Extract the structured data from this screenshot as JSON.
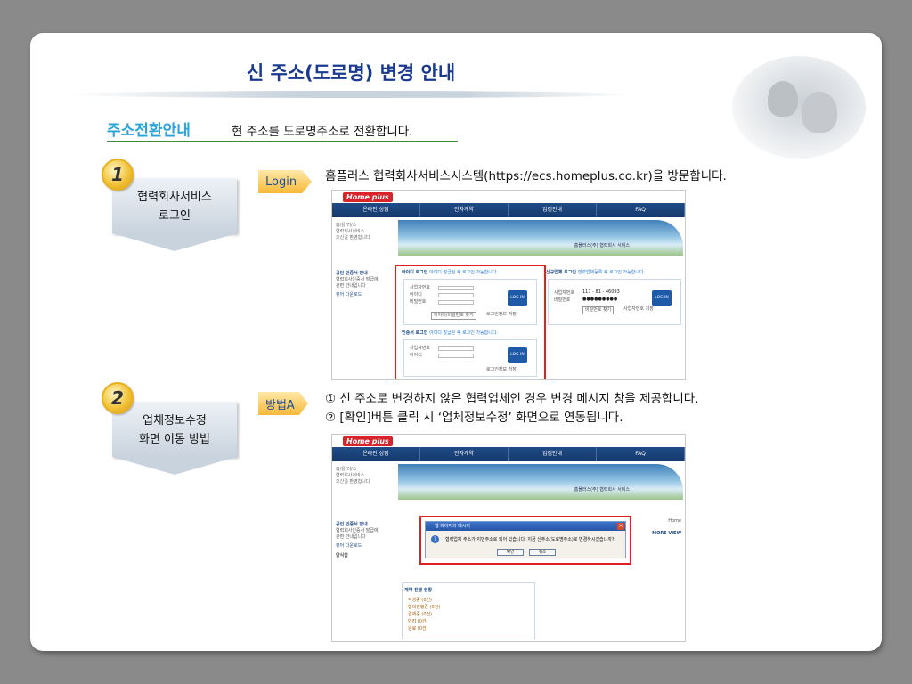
{
  "title": "신 주소(도로명) 변경 안내",
  "section": {
    "title": "주소전환안내",
    "desc": "현 주소를 도로명주소로 전환합니다."
  },
  "steps": [
    {
      "num": "1",
      "label_line1": "협력회사서비스",
      "label_line2": "로그인",
      "tag": "Login",
      "desc": [
        "홈플러스 협력회사서비스시스템(https://ecs.homeplus.co.kr)을 방문합니다."
      ]
    },
    {
      "num": "2",
      "label_line1": "업체정보수정",
      "label_line2": "화면 이동 방법",
      "tag": "방법A",
      "desc": [
        "① 신 주소로 변경하지 않은 협력업체인 경우 변경 메시지 창을 제공합니다.",
        "② [확인]버튼 클릭 시 ‘업체정보수정’ 화면으로 연동됩니다."
      ]
    }
  ],
  "shot1": {
    "logo": "Home plus",
    "nav": [
      "온라인 상담",
      "전자계약",
      "입점안내",
      "FAQ"
    ],
    "side": [
      "홈/플/러/스",
      "협력회사서비스",
      "오신걸 환영합니다"
    ],
    "side2": [
      "공인 인증서 안내",
      "협력회사인증서 발급에",
      "관련 안내입니다",
      "뷰어  다운로드"
    ],
    "banner_text": "홈플러스(주) 협력회사 서비스",
    "id_login": {
      "title": "아이디 로그인",
      "hint": "아이디 발급된 후 로그인 가능합니다.",
      "f1": "사업자번호",
      "f2": "아이디",
      "f3": "비밀번호",
      "btn": "LOG IN",
      "save": "로그인정보 저장",
      "find": "아이디/비밀번호 찾기"
    },
    "cert_login": {
      "title": "인증서 로그인",
      "hint": "아이디 발급된 후 로그인 가능합니다.",
      "f1": "사업자번호",
      "f2": "아이디",
      "btn": "LOG IN",
      "save": "로그인정보 저장"
    },
    "new_login": {
      "title": "신규업체 로그인",
      "hint": "협력업체등록 후 로그인 가능합니다.",
      "f1": "사업자번호",
      "f2": "비밀번호",
      "v1": "117 - 81 - 46093",
      "v2": "●●●●●●●●●",
      "btn": "LOG IN",
      "save": "사업자번호 저장",
      "find": "비밀번호 찾기"
    }
  },
  "shot2": {
    "logo": "Home plus",
    "nav": [
      "온라인 상담",
      "전자계약",
      "입점안내",
      "FAQ"
    ],
    "side": [
      "홈/플/러/스",
      "협력회사서비스",
      "오신걸 환영합니다"
    ],
    "side2": [
      "공인 인증서 안내",
      "협력회사인증서 발급에",
      "관련 안내입니다",
      "뷰어  다운로드",
      "양식함"
    ],
    "banner_text": "홈플러스(주) 협력회사 서비스",
    "home": "Home",
    "more": "MORE VIEW",
    "dialog": {
      "title": "웹 페이지의 메시지",
      "msg": "협력업체 주소가 지번주소로 되어 있습니다. 지금 신주소(도로명주소)로 변경하시겠습니까?",
      "ok": "확인",
      "cancel": "취소"
    },
    "contract": {
      "title": "계약 진행 현황",
      "items": [
        "작성중 (0건)",
        "합의진행중 (0건)",
        "결재중 (0건)",
        "반려 (0건)",
        "완료 (0건)"
      ]
    }
  }
}
